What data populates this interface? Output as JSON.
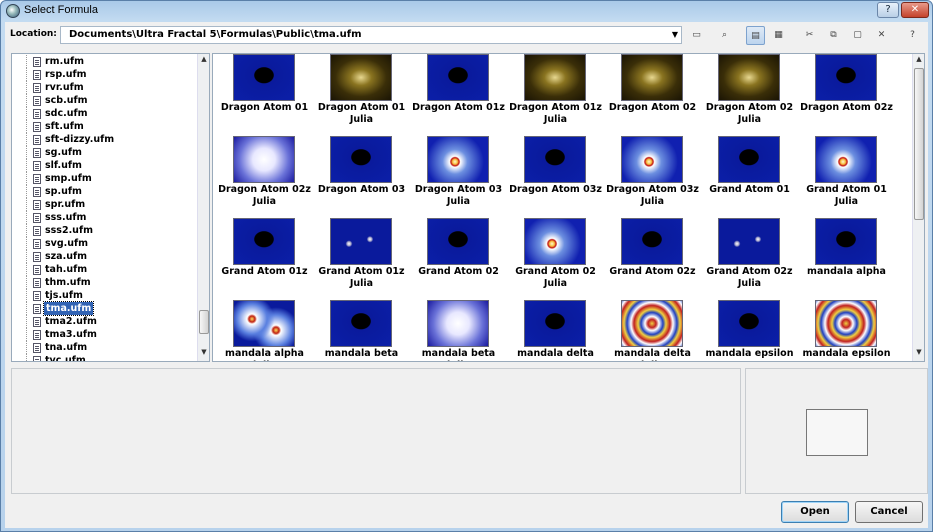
{
  "window": {
    "title": "Select Formula",
    "help": "?",
    "close": "✕"
  },
  "location": {
    "label": "Location:",
    "path": "Documents\\Ultra Fractal 5\\Formulas\\Public\\tma.ufm"
  },
  "toolbar": {
    "icons": [
      "folder-icon",
      "find-icon",
      "large-icons-view-icon",
      "small-icons-view-icon",
      "cut-icon",
      "copy-icon",
      "paste-icon",
      "delete-icon",
      "help-icon"
    ],
    "glyphs": [
      "▭",
      "⌕",
      "▤",
      "▦",
      "✂",
      "⧉",
      "▢",
      "✕",
      "?"
    ]
  },
  "tree": {
    "items": [
      "rm.ufm",
      "rsp.ufm",
      "rvr.ufm",
      "scb.ufm",
      "sdc.ufm",
      "sft.ufm",
      "sft-dizzy.ufm",
      "sg.ufm",
      "slf.ufm",
      "smp.ufm",
      "sp.ufm",
      "spr.ufm",
      "sss.ufm",
      "sss2.ufm",
      "svg.ufm",
      "sza.ufm",
      "tah.ufm",
      "thm.ufm",
      "tjs.ufm",
      "tma.ufm",
      "tma2.ufm",
      "tma3.ufm",
      "tna.ufm",
      "tvc.ufm"
    ],
    "selected": "tma.ufm"
  },
  "formulas": [
    {
      "line1": "Dragon Atom 01",
      "line2": "",
      "style": "dark"
    },
    {
      "line1": "Dragon Atom 01",
      "line2": "Julia",
      "style": "olive"
    },
    {
      "line1": "Dragon Atom 01z",
      "line2": "",
      "style": "dark"
    },
    {
      "line1": "Dragon Atom 01z",
      "line2": "Julia",
      "style": "olive"
    },
    {
      "line1": "Dragon Atom 02",
      "line2": "",
      "style": "olive"
    },
    {
      "line1": "Dragon Atom 02",
      "line2": "Julia",
      "style": "olive"
    },
    {
      "line1": "Dragon Atom 02z",
      "line2": "",
      "style": "dark"
    },
    {
      "line1": "Dragon Atom 02z",
      "line2": "Julia",
      "style": "light"
    },
    {
      "line1": "Dragon Atom 03",
      "line2": "",
      "style": "dark"
    },
    {
      "line1": "Dragon Atom 03",
      "line2": "Julia",
      "style": "glow"
    },
    {
      "line1": "Dragon Atom 03z",
      "line2": "",
      "style": "dark"
    },
    {
      "line1": "Dragon Atom 03z",
      "line2": "Julia",
      "style": "glow"
    },
    {
      "line1": "Grand Atom 01",
      "line2": "",
      "style": "dark"
    },
    {
      "line1": "Grand Atom 01",
      "line2": "Julia",
      "style": "glow"
    },
    {
      "line1": "Grand Atom 01z",
      "line2": "",
      "style": "dark"
    },
    {
      "line1": "Grand Atom 01z",
      "line2": "Julia",
      "style": "dots"
    },
    {
      "line1": "Grand Atom 02",
      "line2": "",
      "style": "dark"
    },
    {
      "line1": "Grand Atom 02",
      "line2": "Julia",
      "style": "glow"
    },
    {
      "line1": "Grand Atom 02z",
      "line2": "",
      "style": "dark"
    },
    {
      "line1": "Grand Atom 02z",
      "line2": "Julia",
      "style": "dots"
    },
    {
      "line1": "mandala alpha",
      "line2": "",
      "style": "dark"
    },
    {
      "line1": "mandala alpha julia",
      "line2": "",
      "style": "swirl"
    },
    {
      "line1": "mandala beta",
      "line2": "",
      "style": "dark"
    },
    {
      "line1": "mandala beta julia",
      "line2": "",
      "style": "light"
    },
    {
      "line1": "mandala delta",
      "line2": "",
      "style": "dark"
    },
    {
      "line1": "mandala delta julia",
      "line2": "",
      "style": "tiles"
    },
    {
      "line1": "mandala epsilon",
      "line2": "",
      "style": "dark"
    },
    {
      "line1": "mandala epsilon",
      "line2": "",
      "style": "tiles"
    }
  ],
  "buttons": {
    "open": "Open",
    "cancel": "Cancel"
  },
  "colors": {
    "selection": "#3163b4",
    "deepblue": "#0a1a9c",
    "olive": "#5a4a10"
  }
}
